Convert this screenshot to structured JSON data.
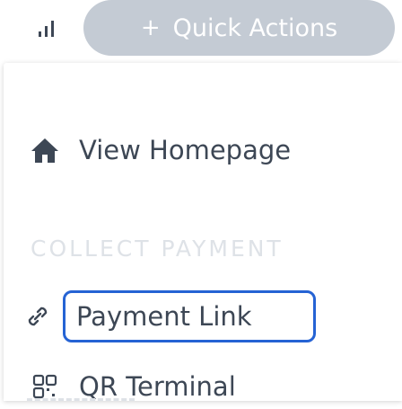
{
  "quick_actions": {
    "label": "Quick Actions",
    "plus": "+"
  },
  "menu": {
    "view_homepage": "View Homepage",
    "section_collect_payment": "COLLECT PAYMENT",
    "payment_link": "Payment Link",
    "qr_terminal": "QR Terminal"
  },
  "colors": {
    "button_bg": "#c4cbd4",
    "text": "#3d4755",
    "focus_border": "#2563d4",
    "section_header": "#dee2e7"
  },
  "icons": {
    "signal": "signal-bars-icon",
    "home": "home-icon",
    "link": "link-icon",
    "qr": "qr-code-icon"
  }
}
